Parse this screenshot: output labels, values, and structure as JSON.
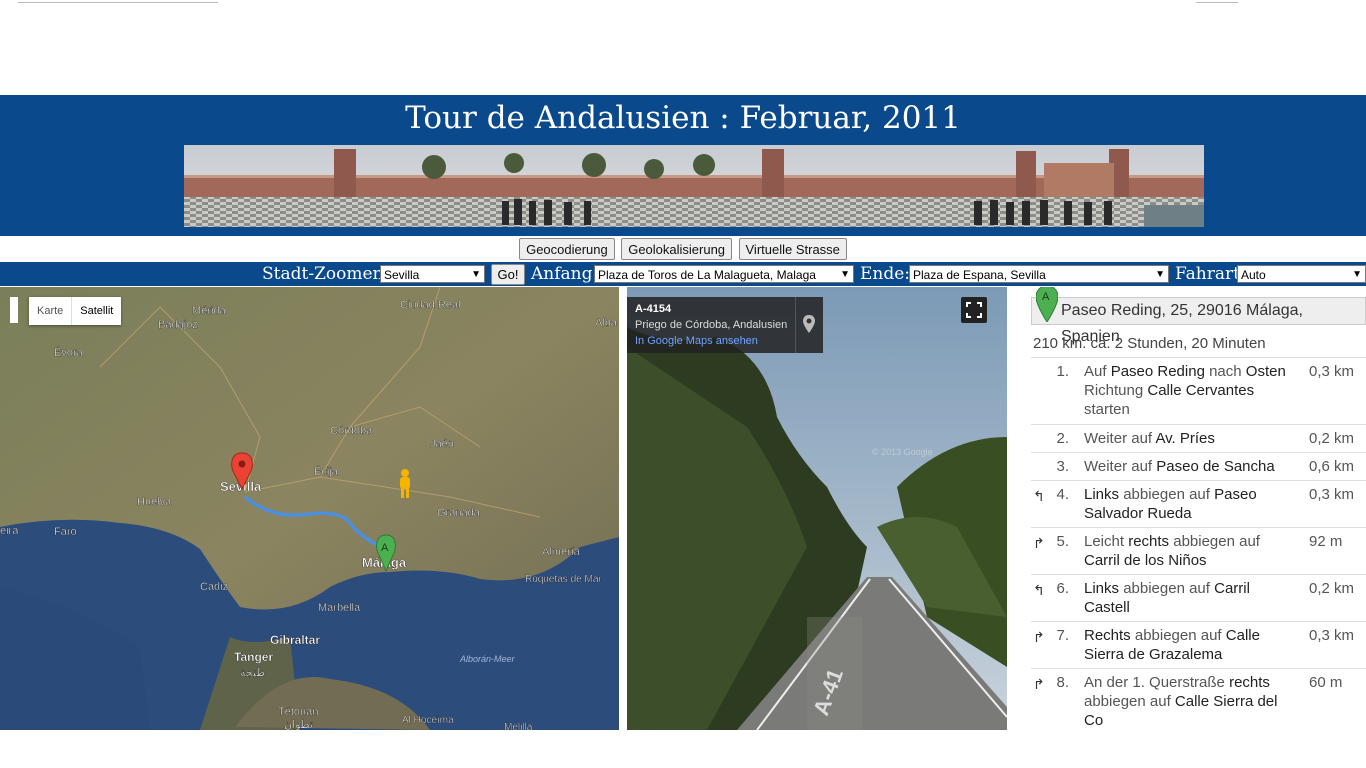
{
  "header": {
    "title": "Tour de Andalusien : Februar, 2011"
  },
  "buttons": {
    "geocode": "Geocodierung",
    "geolocate": "Geolokalisierung",
    "street": "Virtuelle Strasse"
  },
  "controls": {
    "city_label": "Stadt-Zoomen:",
    "city_value": "Sevilla",
    "go_label": "Go!",
    "start_label": "Anfang:",
    "start_value": "Plaza de Toros de La Malagueta, Malaga",
    "end_label": "Ende:",
    "end_value": "Plaza de Espana, Sevilla",
    "mode_label": "Fahrart:",
    "mode_value": "Auto"
  },
  "map": {
    "type_map": "Karte",
    "type_satellite": "Satellit",
    "labels": [
      "Mérida",
      "Badajoz",
      "Évora",
      "Ciudad Real",
      "Alba",
      "Córdoba",
      "Jaén",
      "Écija",
      "Sevilla",
      "Huelva",
      "Faro",
      "eira",
      "Granada",
      "Almería",
      "Málaga",
      "Roquetas de Mar",
      "Cádiz",
      "Marbella",
      "Gibraltar",
      "Tanger",
      "طنجة",
      "Alborán-Meer",
      "Tétouan",
      "تطوان",
      "Al Hoceïma",
      "Melilla"
    ],
    "marker_a": "A"
  },
  "streetview": {
    "road": "A-4154",
    "place": "Priego de Córdoba, Andalusien",
    "link": "In Google Maps ansehen",
    "watermark": "© 2013 Google",
    "road_marking": "A-41"
  },
  "directions": {
    "start_marker": "A",
    "start_address": "Paseo Reding, 25, 29016 Málaga, Spanien",
    "summary": "210 km. ca. 2 Stunden, 20 Minuten",
    "steps": [
      {
        "num": "1.",
        "turn": "",
        "parts": [
          "Auf ",
          "Paseo Reding",
          " nach ",
          "Osten",
          " Richtung ",
          "Calle Cervantes",
          " starten"
        ],
        "dist": "0,3 km"
      },
      {
        "num": "2.",
        "turn": "",
        "parts": [
          "Weiter auf ",
          "Av. Príes"
        ],
        "dist": "0,2 km"
      },
      {
        "num": "3.",
        "turn": "",
        "parts": [
          "Weiter auf ",
          "Paseo de Sancha"
        ],
        "dist": "0,6 km"
      },
      {
        "num": "4.",
        "turn": "↰",
        "parts": [
          "Links",
          " abbiegen auf ",
          "Paseo Salvador Rueda"
        ],
        "dist": "0,3 km"
      },
      {
        "num": "5.",
        "turn": "↱",
        "parts": [
          "Leicht ",
          "rechts",
          " abbiegen auf ",
          "Carril de los Niños"
        ],
        "dist": "92 m"
      },
      {
        "num": "6.",
        "turn": "↰",
        "parts": [
          "Links",
          " abbiegen auf ",
          "Carril Castell"
        ],
        "dist": "0,2 km"
      },
      {
        "num": "7.",
        "turn": "↱",
        "parts": [
          "Rechts",
          " abbiegen auf ",
          "Calle Sierra de Grazalema"
        ],
        "dist": "0,3 km"
      },
      {
        "num": "8.",
        "turn": "↱",
        "parts": [
          "An der 1. Querstraße ",
          "rechts",
          " abbiegen auf ",
          "Calle Sierra del Co"
        ],
        "dist": "60 m"
      }
    ]
  }
}
